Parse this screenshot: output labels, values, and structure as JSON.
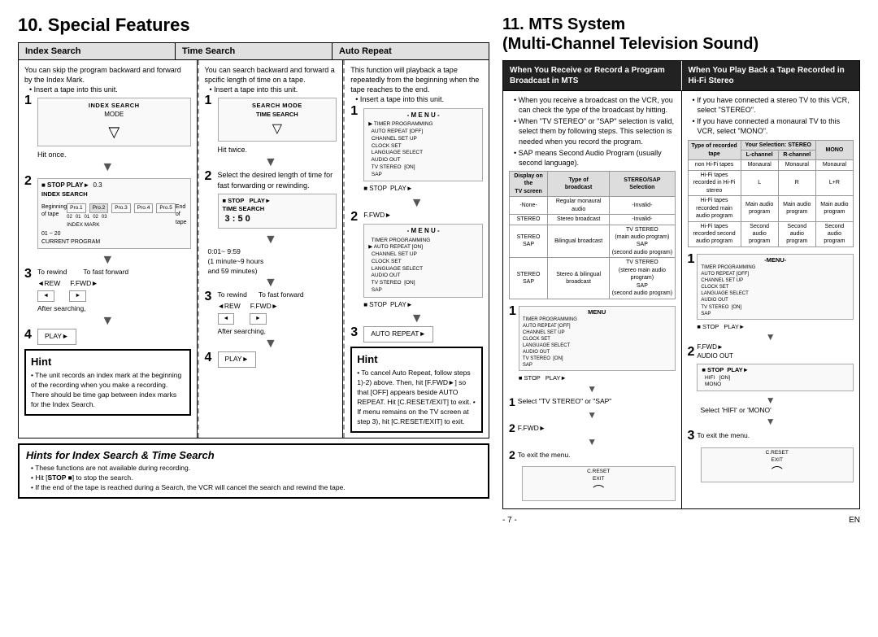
{
  "left": {
    "title": "10. Special Features",
    "tabs": [
      {
        "id": "index-search",
        "label": "Index Search",
        "intro": "You can skip the program backward and forward by the Index Mark.",
        "bullet1": "Insert a tape into this unit.",
        "steps": [
          {
            "num": "1",
            "text": "Hit once.",
            "diagram": "INDEX SEARCH MODE"
          },
          {
            "num": "2",
            "text": "",
            "diagram": "STOP PLAY 0.3 / INDEX SEARCH"
          },
          {
            "num": "3",
            "text": "To rewind     To fast forward\n◄REW            F.FWD►\n\nAfter searching,"
          },
          {
            "num": "4",
            "text": "PLAY►"
          }
        ],
        "hint_title": "Hint",
        "hint_text": "• The unit records an index mark at the beginning of the recording when you make a recording. There should be time gap between index marks for the Index Search."
      },
      {
        "id": "time-search",
        "label": "Time Search",
        "intro": "You can search backward and forward a spcific length of time on a tape.",
        "bullet1": "Insert a tape into this unit.",
        "steps": [
          {
            "num": "1",
            "text": "Hit twice.",
            "diagram": "SEARCH MODE / TIME SEARCH"
          },
          {
            "num": "2",
            "text": "Select the desired length of time for fast forwarding or rewinding.",
            "diagram": "STOP PLAY / TIME SEARCH 3:50"
          },
          {
            "num": "",
            "text": "0:01~ 9:59\n(1 minute~9 hours\nand 59 minutes)"
          },
          {
            "num": "3",
            "text": "To rewind     To fast forward\n◄REW            F.FWD►\n\nAfter searching,"
          },
          {
            "num": "4",
            "text": "PLAY►"
          }
        ]
      },
      {
        "id": "auto-repeat",
        "label": "Auto Repeat",
        "intro": "This function will playback a tape repeatedly from the beginning when the tape reaches to the end.",
        "bullet1": "Insert a tape into this unit.",
        "steps": [
          {
            "num": "1",
            "text": "",
            "diagram": "MENU > TIMER PROGRAMMING / AUTO REPEAT [OFF] / CHANNEL SET UP / CLOCK SET / LANGUAGE SELECT / AUDIO OUT / TV STEREO [ON] / SAP"
          },
          {
            "num": "2",
            "text": "F.FWD►",
            "diagram": "MENU > AUTO REPEAT [ON]"
          },
          {
            "num": "3",
            "text": "AUTO REPEAT►"
          }
        ],
        "hint_title": "Hint",
        "hint_text": "• To cancel Auto Repeat, follow steps 1)-2) above. Then, hit [F.FWD►] so that [OFF] appears beside AUTO REPEAT. Hit [C.RESET/EXIT] to exit.\n• If menu remains on the TV screen at step 3), hit [C.RESET/EXIT] to exit."
      }
    ],
    "hints_section": {
      "title": "Hints for Index Search & Time Search",
      "items": [
        "These functions are not available during recording.",
        "Hit [STOP ■] to stop the search.",
        "If the end of the tape is reached during a Search, the VCR will cancel the search and rewind the tape."
      ]
    }
  },
  "right": {
    "title": "11. MTS System",
    "subtitle": "(Multi-Channel Television Sound)",
    "panels": [
      {
        "id": "receive-record",
        "label": "When You Receive or Record a Program Broadcast in MTS",
        "bullets": [
          "When you receive a broadcast on the VCR, you can check the type of the broadcast by hitting.",
          "When \"TV STEREO\" or \"SAP\" selection is valid, select them by following steps. This selection is needed when you record the program.",
          "SAP means Second Audio Program (usually second language)."
        ],
        "table": {
          "headers": [
            "Display on the TV screen",
            "Type of broadcast",
            "STEREO/SAP Selection"
          ],
          "rows": [
            [
              "-None-",
              "Regular monaural audio",
              "-Invalid-"
            ],
            [
              "STEREO",
              "Stereo broadcast",
              "-Invalid-"
            ],
            [
              "STEREO SAP",
              "Bilingual broadcast",
              "TV STEREO (main audio program) / SAP (second audio program)"
            ],
            [
              "STEREO SAP",
              "Stereo & bilingual broadcast",
              "TV STEREO (stereo main audio program) / SAP (second audio program)"
            ]
          ]
        },
        "mts_steps": [
          {
            "num": "1",
            "diagram": "MENU box with TIMER PROGRAMMING / AUTO REPEAT [OFF] / CHANNEL SET UP / CLOCK SET / LANGUAGE SELECT / AUDIO OUT / TV STEREO [ON] / SAP"
          },
          {
            "num": "1",
            "text": "Select 'TV STEREO' or 'SAP'"
          },
          {
            "num": "2",
            "text": "F.FWD►"
          },
          {
            "num": "2",
            "text": "To exit the menu."
          }
        ]
      },
      {
        "id": "playback-hifi",
        "label": "When You Play Back a Tape Recorded in Hi-Fi Stereo",
        "bullets": [
          "If you have connected a stereo TV to this VCR, select \"STEREO\".",
          "If you have connected a monaural TV to this VCR, select \"MONO\"."
        ],
        "table2": {
          "headers": [
            "Your Selection",
            "STEREO",
            "",
            "MONO"
          ],
          "subheaders": [
            "Type of recorded tape",
            "L-channel",
            "R-channel",
            ""
          ],
          "rows": [
            [
              "non Hi-Fi tapes",
              "Monaural",
              "Monaural",
              "Monaural"
            ],
            [
              "Hi-Fi tapes recorded in Hi-Fi stereo",
              "L",
              "R",
              "L+R"
            ],
            [
              "Hi-Fi tapes recorded main audio program",
              "Main audio program",
              "Main audio program",
              "Main audio program"
            ],
            [
              "Hi-Fi tapes recorded second audio program",
              "Second audio program",
              "Second audio program",
              "Second audio program"
            ]
          ]
        },
        "mts_steps2": [
          {
            "num": "1",
            "diagram": "MENU with TIMER PROGRAMMING / AUTO REPEAT [OFF] / CHANNEL SET UP / CLOCK SET / LANGUAGE SELECT / AUDIO OUT / TV STEREO [ON] / SAP"
          },
          {
            "num": "2",
            "text": "F.FWD►\nAUDIO OUT",
            "sub": "HIFI [ON] / MONO"
          },
          {
            "num": "",
            "text": "Select 'HIFI' or 'MONO'"
          },
          {
            "num": "3",
            "text": "To exit the menu."
          }
        ]
      }
    ]
  },
  "footer": {
    "page_num": "- 7 -",
    "lang": "EN"
  }
}
